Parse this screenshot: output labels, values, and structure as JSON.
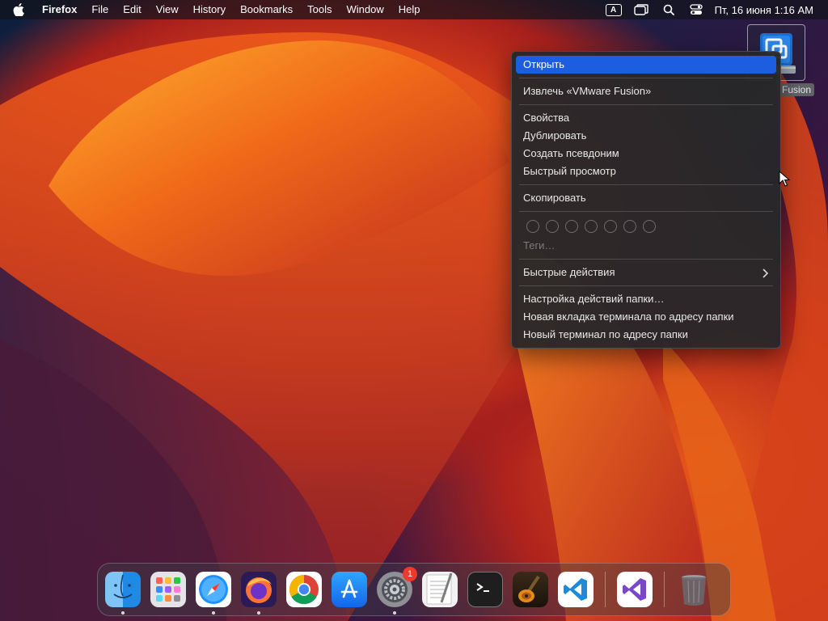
{
  "menubar": {
    "app_name": "Firefox",
    "items": [
      "File",
      "Edit",
      "View",
      "History",
      "Bookmarks",
      "Tools",
      "Window",
      "Help"
    ],
    "keyboard_indicator": "A",
    "clock": "Пт, 16 июня  1:16 AM"
  },
  "desktop_icon": {
    "label": "Fusion",
    "icon": "vmware-fusion-disk-icon"
  },
  "context_menu": {
    "open": "Открыть",
    "eject": "Извлечь «VMware Fusion»",
    "properties": "Свойства",
    "duplicate": "Дублировать",
    "make_alias": "Создать псевдоним",
    "quick_look": "Быстрый просмотр",
    "copy": "Скопировать",
    "tags": "Теги…",
    "quick_actions": "Быстрые действия",
    "folder_actions_setup": "Настройка действий папки…",
    "new_terminal_tab_at_folder": "Новая вкладка терминала по адресу папки",
    "new_terminal_at_folder": "Новый терминал по адресу папки"
  },
  "dock": {
    "apps": [
      {
        "name": "Finder",
        "icon": "finder-icon",
        "running": true
      },
      {
        "name": "Launchpad",
        "icon": "launchpad-icon",
        "running": false
      },
      {
        "name": "Safari",
        "icon": "safari-icon",
        "running": true
      },
      {
        "name": "Firefox",
        "icon": "firefox-icon",
        "running": true
      },
      {
        "name": "Google Chrome",
        "icon": "chrome-icon",
        "running": false
      },
      {
        "name": "App Store",
        "icon": "app-store-icon",
        "running": false
      },
      {
        "name": "System Settings",
        "icon": "settings-icon",
        "running": true,
        "badge": "1"
      },
      {
        "name": "TextEdit",
        "icon": "textedit-icon",
        "running": false
      },
      {
        "name": "Terminal",
        "icon": "terminal-icon",
        "running": false
      },
      {
        "name": "GarageBand",
        "icon": "garageband-icon",
        "running": false
      },
      {
        "name": "Visual Studio Code",
        "icon": "vscode-icon",
        "running": false
      },
      {
        "name": "Visual Studio",
        "icon": "visual-studio-icon",
        "running": false
      },
      {
        "name": "Trash",
        "icon": "trash-icon",
        "running": false
      }
    ]
  },
  "colors": {
    "menu_highlight": "#1d5ee0",
    "badge": "#f0392e"
  }
}
